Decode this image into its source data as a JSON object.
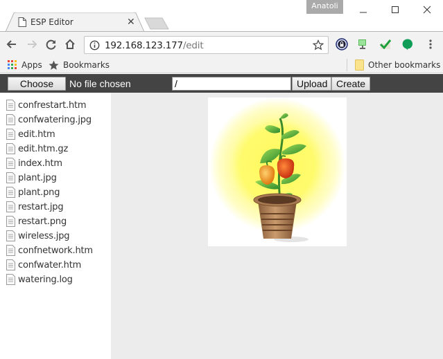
{
  "browser": {
    "tab": {
      "title": "ESP Editor",
      "close_icon": "close-icon",
      "favicon": "page-icon"
    },
    "user_badge": "Anatoli",
    "window_controls": [
      "minimize",
      "maximize",
      "close"
    ],
    "toolbar": {
      "url_host": "192.168.123.177",
      "url_path": "/edit",
      "nav_icons": [
        "back-icon",
        "forward-icon",
        "reload-icon",
        "home-icon"
      ],
      "extensions": [
        "lock-extension-icon",
        "remote-desktop-extension-icon",
        "checkmark-extension-icon",
        "hangouts-extension-icon",
        "menu-icon"
      ]
    },
    "bookmarks": {
      "apps_label": "Apps",
      "bookmarks_label": "Bookmarks",
      "other_label": "Other bookmarks"
    }
  },
  "page": {
    "uploader": {
      "choose_file_label": "Choose File",
      "no_file_text": "No file chosen",
      "path_value": "/",
      "upload_label": "Upload",
      "create_label": "Create"
    },
    "files": [
      "confrestart.htm",
      "confwatering.jpg",
      "edit.htm",
      "edit.htm.gz",
      "index.htm",
      "plant.jpg",
      "plant.png",
      "restart.jpg",
      "restart.png",
      "wireless.jpg",
      "confnetwork.htm",
      "confwater.htm",
      "watering.log"
    ],
    "preview": {
      "alt": "Potted pepper plant in a yellow glow"
    }
  },
  "colors": {
    "uploader_bg": "#444444",
    "preview_bg": "#ececec",
    "toolbar_bg": "#f2f2f2"
  }
}
